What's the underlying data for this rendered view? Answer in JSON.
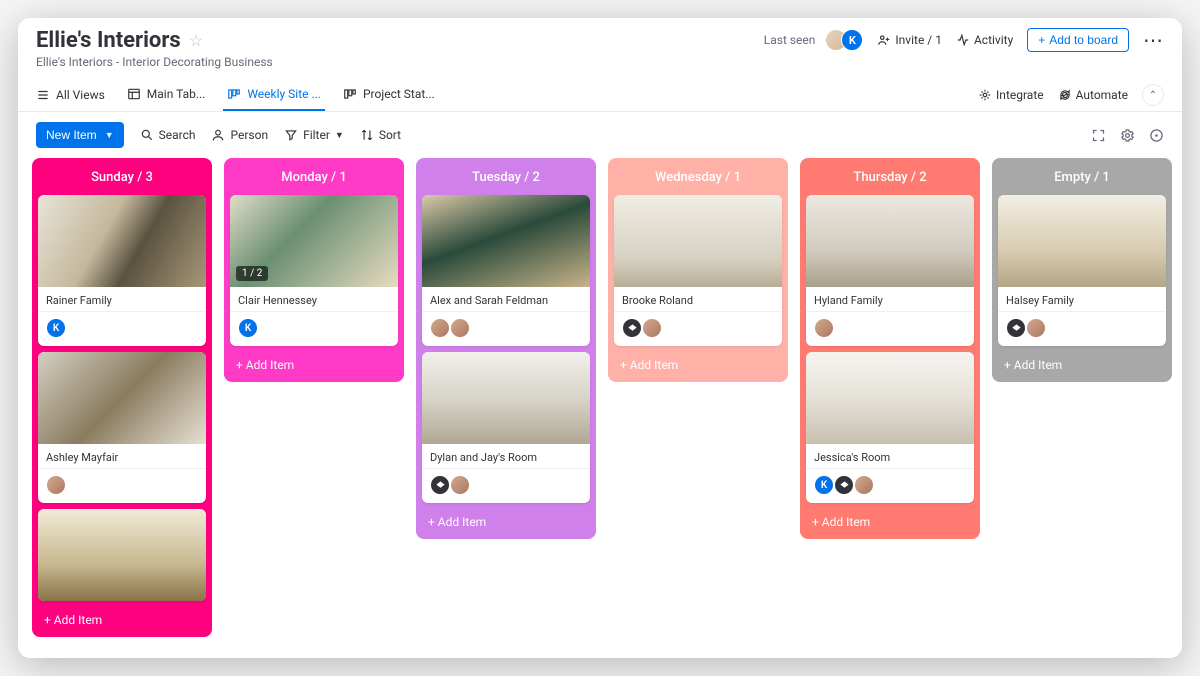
{
  "header": {
    "title": "Ellie's Interiors",
    "subtitle": "Ellie's Interiors - Interior Decorating Business",
    "last_seen": "Last seen",
    "invite": "Invite / 1",
    "activity": "Activity",
    "add_to_board": "Add to board",
    "avatar_initial": "K"
  },
  "tabs": {
    "all_views": "All Views",
    "items": [
      {
        "label": "Main Tab..."
      },
      {
        "label": "Weekly Site ..."
      },
      {
        "label": "Project Stat..."
      }
    ],
    "active_index": 1,
    "integrate": "Integrate",
    "automate": "Automate"
  },
  "toolbar": {
    "new_item": "New Item",
    "search": "Search",
    "person": "Person",
    "filter": "Filter",
    "sort": "Sort"
  },
  "columns": [
    {
      "title": "Sunday / 3",
      "color_class": "c0",
      "cards": [
        {
          "title": "Rainer Family",
          "img": "img0",
          "badges": [
            "K"
          ]
        },
        {
          "title": "Ashley Mayfair",
          "img": "img1",
          "badges": [
            "avatar"
          ]
        },
        {
          "title": "",
          "img": "img2",
          "badges": [],
          "partial": true
        }
      ],
      "add_item": "+ Add Item"
    },
    {
      "title": "Monday / 1",
      "color_class": "c1",
      "cards": [
        {
          "title": "Clair Hennessey",
          "img": "img3",
          "badges": [
            "K"
          ],
          "counter": "1 / 2"
        }
      ],
      "add_item": "+ Add Item"
    },
    {
      "title": "Tuesday / 2",
      "color_class": "c2",
      "cards": [
        {
          "title": "Alex and Sarah Feldman",
          "img": "img4",
          "badges": [
            "avatar",
            "avatar2"
          ]
        },
        {
          "title": "Dylan and Jay's Room",
          "img": "img5",
          "badges": [
            "org",
            "avatar"
          ]
        }
      ],
      "add_item": "+ Add Item"
    },
    {
      "title": "Wednesday / 1",
      "color_class": "c3",
      "cards": [
        {
          "title": "Brooke Roland",
          "img": "img6",
          "badges": [
            "org",
            "avatar"
          ]
        }
      ],
      "add_item": "+ Add Item"
    },
    {
      "title": "Thursday / 2",
      "color_class": "c4",
      "cards": [
        {
          "title": "Hyland Family",
          "img": "img7",
          "badges": [
            "avatar"
          ]
        },
        {
          "title": "Jessica's Room",
          "img": "img8",
          "badges": [
            "K",
            "org",
            "avatar"
          ]
        }
      ],
      "add_item": "+ Add Item"
    },
    {
      "title": "Empty / 1",
      "color_class": "c5",
      "cards": [
        {
          "title": "Halsey Family",
          "img": "img9",
          "badges": [
            "org",
            "avatar"
          ]
        }
      ],
      "add_item": "+ Add Item"
    }
  ]
}
